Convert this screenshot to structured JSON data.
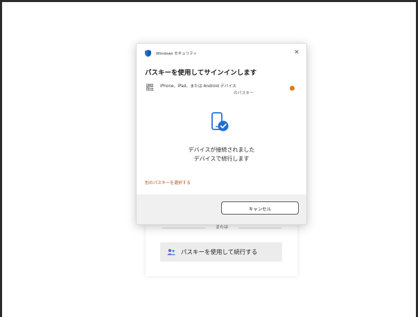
{
  "background_card": {
    "or_text": "または",
    "passkey_button_label": "パスキーを使用して続行する",
    "icons": [
      "person-icon"
    ]
  },
  "dialog": {
    "app_title": "Windows セキュリティ",
    "close_glyph": "✕",
    "heading": "パスキーを使用してサインインします",
    "device_line1": "iPhone、iPad、または Android デバイス",
    "device_line2": "のパスキー",
    "status_line1": "デバイスが接続されました",
    "status_line2": "デバイスで続行します",
    "alt_link": "別のパスキーを選択する",
    "cancel_label": "キャンセル",
    "icons": [
      "shield-icon",
      "qr-code-icon",
      "warning-dot-icon",
      "phone-check-icon",
      "close-icon"
    ]
  },
  "colors": {
    "accent_blue": "#1f6fd1",
    "link_orange": "#b3501a",
    "warning_orange": "#e07b12",
    "footer_gray": "#f0f0f0"
  }
}
